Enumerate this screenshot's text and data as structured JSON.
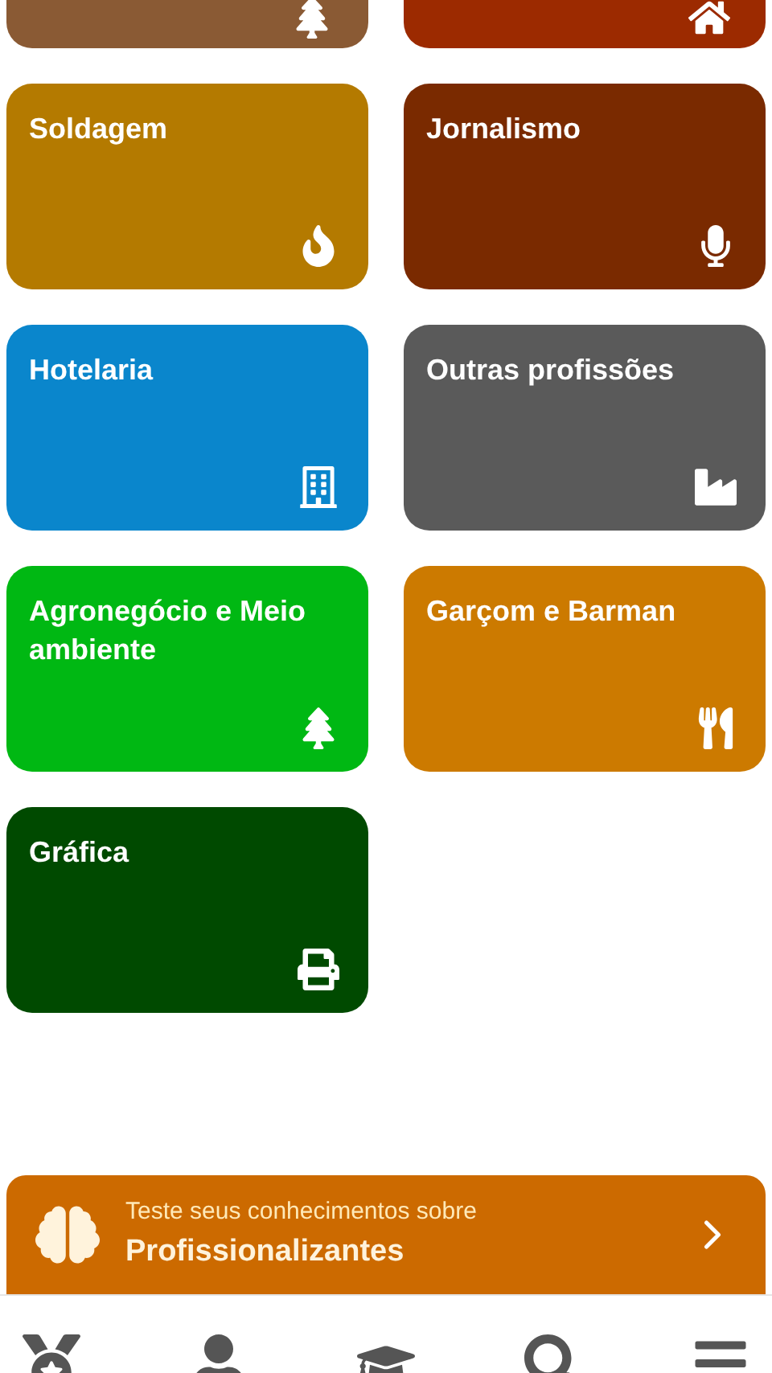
{
  "categories": [
    {
      "color": "#8a5a34",
      "kind": "tree"
    },
    {
      "color": "#9c2a00",
      "kind": "home"
    },
    {
      "title": "Soldagem",
      "color": "#b47a00",
      "kind": "fire"
    },
    {
      "title": "Jornalismo",
      "color": "#7a2a00",
      "kind": "microphone"
    },
    {
      "title": "Hotelaria",
      "color": "#0a86cc",
      "kind": "building"
    },
    {
      "title": "Outras profissões",
      "color": "#5a5a5a",
      "kind": "industry"
    },
    {
      "title": "Agronegócio e Meio ambiente",
      "color": "#00b813",
      "kind": "tree"
    },
    {
      "title": "Garçom e Barman",
      "color": "#cc7a00",
      "kind": "utensils"
    },
    {
      "title": "Gráfica",
      "color": "#004a00",
      "kind": "print"
    }
  ],
  "quiz_banner": {
    "caption": "Teste seus conhecimentos sobre",
    "subject": "Profissionalizantes"
  },
  "bottom_nav": [
    {
      "kind": "medal"
    },
    {
      "kind": "user"
    },
    {
      "kind": "graduation"
    },
    {
      "kind": "search"
    },
    {
      "kind": "menu"
    }
  ]
}
